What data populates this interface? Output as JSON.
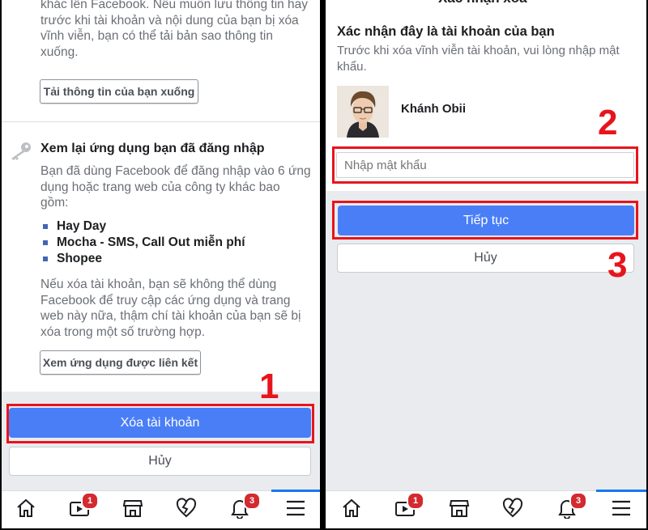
{
  "left": {
    "download_text": [
      "khác lên Facebook. Nếu muốn lưu thông tin hay",
      "trước khi tài khoản và nội dung của bạn bị xóa",
      "vĩnh viễn, bạn có thể tải bản sao thông tin",
      "xuống."
    ],
    "download_button": "Tải thông tin của bạn xuống",
    "apps_heading": "Xem lại ứng dụng bạn đã đăng nhập",
    "apps_text": [
      "Bạn đã dùng Facebook để đăng nhập vào 6 ứng",
      "dụng hoặc trang web của công ty khác bao",
      "gồm:"
    ],
    "apps": [
      "Hay Day",
      "Mocha - SMS, Call Out miễn phí",
      "Shopee"
    ],
    "warning_text": [
      "Nếu xóa tài khoản, bạn sẽ không thể dùng",
      "Facebook để truy cập các ứng dụng và trang",
      "web này nữa, thậm chí tài khoản của bạn sẽ bị",
      "xóa trong một số trường hợp."
    ],
    "linked_apps_button": "Xem ứng dụng được liên kết",
    "delete_button": "Xóa tài khoản",
    "cancel_button": "Hủy",
    "step_label": "1"
  },
  "right": {
    "nav_title": "Xác nhận xóa",
    "heading": "Xác nhận đây là tài khoản của bạn",
    "subtext": [
      "Trước khi xóa vĩnh viễn tài khoản, vui lòng nhập mật",
      "khẩu."
    ],
    "user_name": "Khánh Obii",
    "password_placeholder": "Nhập mật khẩu",
    "continue_button": "Tiếp tục",
    "cancel_button": "Hủy",
    "step2_label": "2",
    "step3_label": "3"
  },
  "tabbar": {
    "watch_badge": "1",
    "notifications_badge": "3",
    "icons": [
      "home-icon",
      "watch-icon",
      "marketplace-icon",
      "dating-icon",
      "notifications-icon",
      "menu-icon"
    ]
  },
  "colors": {
    "accent": "#4a7ef7",
    "annotation_red": "#e8141c",
    "badge_red": "#d32a2f"
  }
}
